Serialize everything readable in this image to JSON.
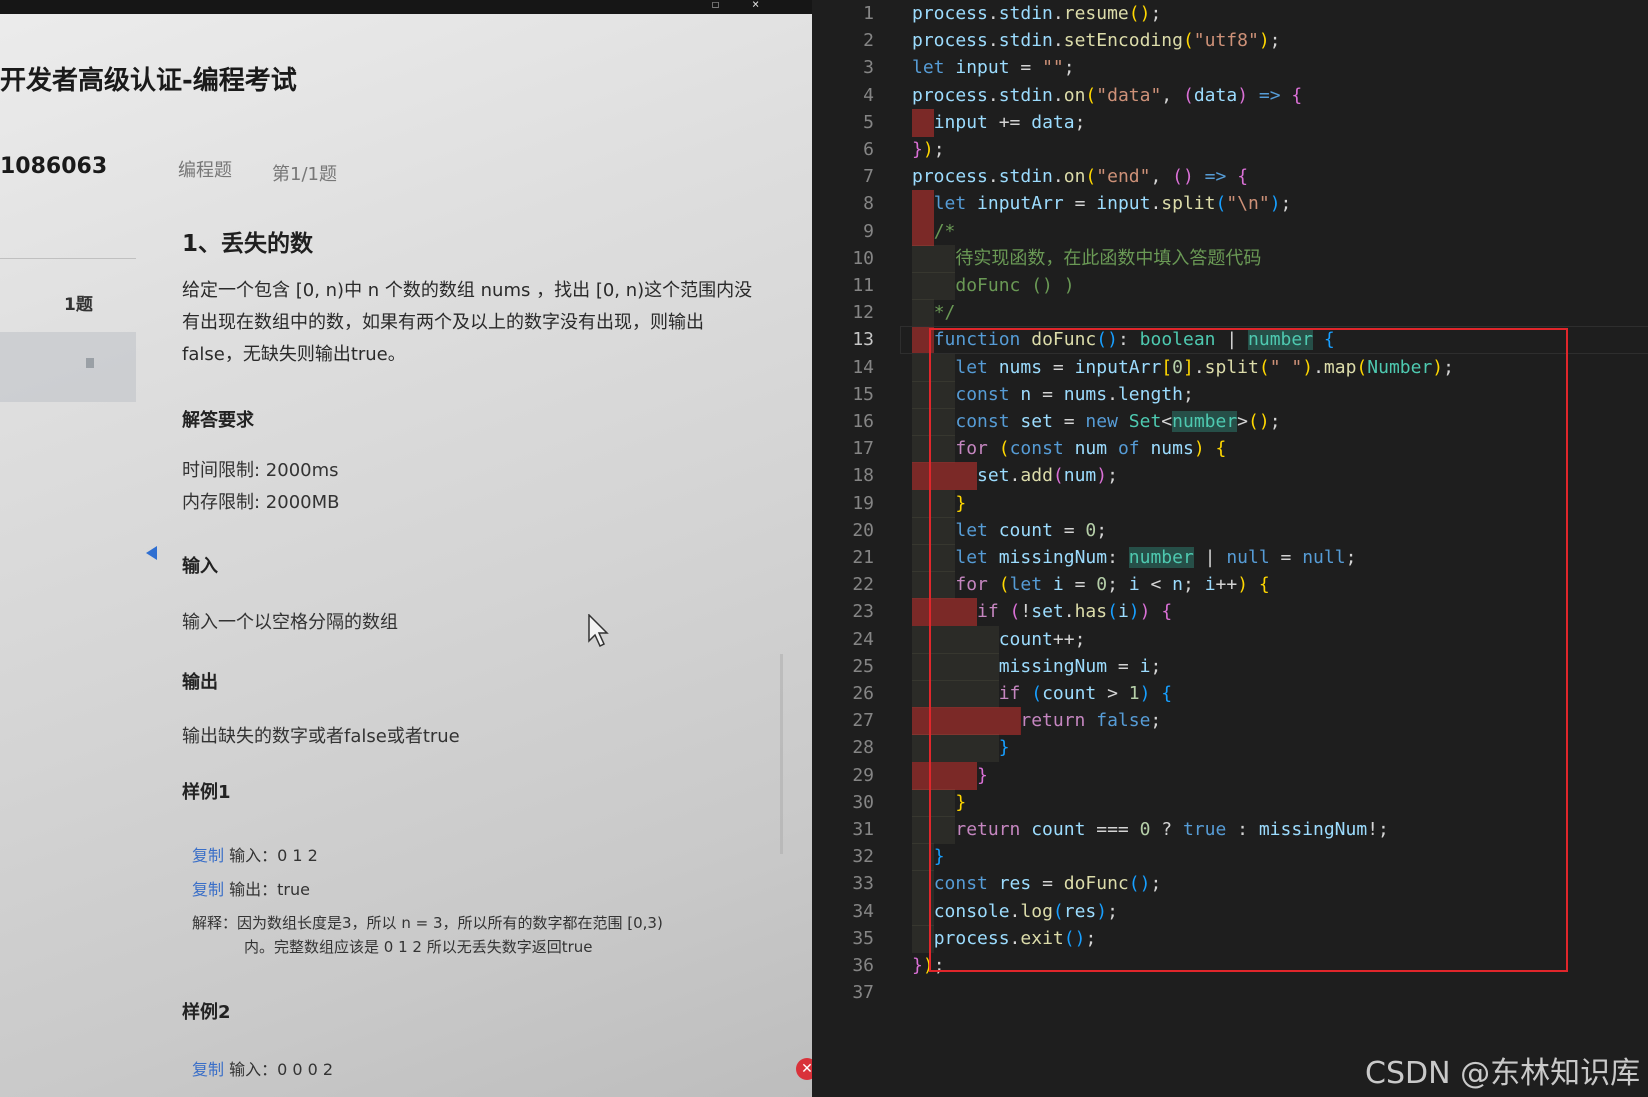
{
  "exam": {
    "title": "开发者高级认证-编程考试",
    "id": "1086063",
    "question_type": "编程题",
    "question_index": "第1/1题",
    "sidebar_question": "1题",
    "question_title": "1、丢失的数",
    "description": [
      "给定一个包含 [0, n)中 n 个数的数组 nums ，找出 [0, n)这个范围内没",
      "有出现在数组中的数，如果有两个及以上的数字没有出现，则输出",
      "false，无缺失则输出true。"
    ],
    "requirements_heading": "解答要求",
    "time_limit": "时间限制: 2000ms",
    "memory_limit": "内存限制: 2000MB",
    "input_heading": "输入",
    "input_text": "输入一个以空格分隔的数组",
    "output_heading": "输出",
    "output_text": "输出缺失的数字或者false或者true",
    "sample1_heading": "样例1",
    "sample1_input": "输入：0 1 2",
    "sample1_output": "输出：true",
    "sample1_explain_label": "解释：",
    "sample1_explain_1": "因为数组长度是3，所以 n = 3，所以所有的数字都在范围 [0,3)",
    "sample1_explain_2": "内。完整数组应该是 0 1 2 所以无丢失数字返回true",
    "sample2_heading": "样例2",
    "sample2_input": "输入：0 0 0 2",
    "copy_label": "复制"
  },
  "editor": {
    "active_line": 13,
    "lines": [
      {
        "n": "1",
        "tokens": [
          [
            "vr",
            "process"
          ],
          [
            "op",
            "."
          ],
          [
            "vr",
            "stdin"
          ],
          [
            "op",
            "."
          ],
          [
            "fn",
            "resume"
          ],
          [
            "b1",
            "()"
          ],
          [
            "op",
            ";"
          ]
        ]
      },
      {
        "n": "2",
        "tokens": [
          [
            "vr",
            "process"
          ],
          [
            "op",
            "."
          ],
          [
            "vr",
            "stdin"
          ],
          [
            "op",
            "."
          ],
          [
            "fn",
            "setEncoding"
          ],
          [
            "b1",
            "("
          ],
          [
            "st",
            "\"utf8\""
          ],
          [
            "b1",
            ")"
          ],
          [
            "op",
            ";"
          ]
        ]
      },
      {
        "n": "3",
        "tokens": [
          [
            "kw",
            "let "
          ],
          [
            "vr",
            "input"
          ],
          [
            "op",
            " = "
          ],
          [
            "st",
            "\"\""
          ],
          [
            "op",
            ";"
          ]
        ]
      },
      {
        "n": "4",
        "tokens": [
          [
            "vr",
            "process"
          ],
          [
            "op",
            "."
          ],
          [
            "vr",
            "stdin"
          ],
          [
            "op",
            "."
          ],
          [
            "fn",
            "on"
          ],
          [
            "b1",
            "("
          ],
          [
            "st",
            "\"data\""
          ],
          [
            "op",
            ", "
          ],
          [
            "b2",
            "("
          ],
          [
            "vr",
            "data"
          ],
          [
            "b2",
            ")"
          ],
          [
            "op",
            " "
          ],
          [
            "kw",
            "=>"
          ],
          [
            "op",
            " "
          ],
          [
            "b2",
            "{"
          ]
        ]
      },
      {
        "n": "5",
        "tokens": [
          [
            "op",
            "  "
          ],
          [
            "vr",
            "input"
          ],
          [
            "op",
            " += "
          ],
          [
            "vr",
            "data"
          ],
          [
            "op",
            ";"
          ]
        ]
      },
      {
        "n": "6",
        "tokens": [
          [
            "b2",
            "}"
          ],
          [
            "b1",
            ")"
          ],
          [
            "op",
            ";"
          ]
        ]
      },
      {
        "n": "7",
        "tokens": [
          [
            "vr",
            "process"
          ],
          [
            "op",
            "."
          ],
          [
            "vr",
            "stdin"
          ],
          [
            "op",
            "."
          ],
          [
            "fn",
            "on"
          ],
          [
            "b1",
            "("
          ],
          [
            "st",
            "\"end\""
          ],
          [
            "op",
            ", "
          ],
          [
            "b2",
            "()"
          ],
          [
            "op",
            " "
          ],
          [
            "kw",
            "=>"
          ],
          [
            "op",
            " "
          ],
          [
            "b2",
            "{"
          ]
        ]
      },
      {
        "n": "8",
        "tokens": [
          [
            "op",
            "  "
          ],
          [
            "kw",
            "let "
          ],
          [
            "vr",
            "inputArr"
          ],
          [
            "op",
            " = "
          ],
          [
            "vr",
            "input"
          ],
          [
            "op",
            "."
          ],
          [
            "fn",
            "split"
          ],
          [
            "b3",
            "("
          ],
          [
            "st",
            "\"\\n\""
          ],
          [
            "b3",
            ")"
          ],
          [
            "op",
            ";"
          ]
        ]
      },
      {
        "n": "9",
        "tokens": [
          [
            "op",
            "  "
          ],
          [
            "cm",
            "/*"
          ]
        ]
      },
      {
        "n": "10",
        "tokens": [
          [
            "op",
            "    "
          ],
          [
            "cm",
            "待实现函数，在此函数中填入答题代码"
          ]
        ]
      },
      {
        "n": "11",
        "tokens": [
          [
            "op",
            "    "
          ],
          [
            "cm",
            "doFunc () )"
          ]
        ]
      },
      {
        "n": "12",
        "tokens": [
          [
            "op",
            "  "
          ],
          [
            "cm",
            "*/"
          ]
        ]
      },
      {
        "n": "13",
        "tokens": [
          [
            "op",
            "  "
          ],
          [
            "kw",
            "function "
          ],
          [
            "fn",
            "doFunc"
          ],
          [
            "b3",
            "()"
          ],
          [
            "op",
            ": "
          ],
          [
            "ty",
            "boolean"
          ],
          [
            "op",
            " | "
          ],
          [
            "tyh",
            "number"
          ],
          [
            "op",
            " "
          ],
          [
            "b3",
            "{"
          ]
        ]
      },
      {
        "n": "14",
        "tokens": [
          [
            "op",
            "    "
          ],
          [
            "kw",
            "let "
          ],
          [
            "vr",
            "nums"
          ],
          [
            "op",
            " = "
          ],
          [
            "vr",
            "inputArr"
          ],
          [
            "b1",
            "["
          ],
          [
            "nm",
            "0"
          ],
          [
            "b1",
            "]"
          ],
          [
            "op",
            "."
          ],
          [
            "fn",
            "split"
          ],
          [
            "b1",
            "("
          ],
          [
            "st",
            "\" \""
          ],
          [
            "b1",
            ")"
          ],
          [
            "op",
            "."
          ],
          [
            "fn",
            "map"
          ],
          [
            "b1",
            "("
          ],
          [
            "ty",
            "Number"
          ],
          [
            "b1",
            ")"
          ],
          [
            "op",
            ";"
          ]
        ]
      },
      {
        "n": "15",
        "tokens": [
          [
            "op",
            "    "
          ],
          [
            "kw",
            "const "
          ],
          [
            "vr",
            "n"
          ],
          [
            "op",
            " = "
          ],
          [
            "vr",
            "nums"
          ],
          [
            "op",
            "."
          ],
          [
            "vr",
            "length"
          ],
          [
            "op",
            ";"
          ]
        ]
      },
      {
        "n": "16",
        "tokens": [
          [
            "op",
            "    "
          ],
          [
            "kw",
            "const "
          ],
          [
            "vr",
            "set"
          ],
          [
            "op",
            " = "
          ],
          [
            "kw",
            "new "
          ],
          [
            "ty",
            "Set"
          ],
          [
            "op",
            "<"
          ],
          [
            "tyh",
            "number"
          ],
          [
            "op",
            ">"
          ],
          [
            "b1",
            "()"
          ],
          [
            "op",
            ";"
          ]
        ]
      },
      {
        "n": "17",
        "tokens": [
          [
            "op",
            "    "
          ],
          [
            "ctl",
            "for "
          ],
          [
            "b1",
            "("
          ],
          [
            "kw",
            "const "
          ],
          [
            "vr",
            "num"
          ],
          [
            "kw",
            " of "
          ],
          [
            "vr",
            "nums"
          ],
          [
            "b1",
            ")"
          ],
          [
            "op",
            " "
          ],
          [
            "b1",
            "{"
          ]
        ]
      },
      {
        "n": "18",
        "tokens": [
          [
            "op",
            "      "
          ],
          [
            "vr",
            "set"
          ],
          [
            "op",
            "."
          ],
          [
            "fn",
            "add"
          ],
          [
            "b2",
            "("
          ],
          [
            "vr",
            "num"
          ],
          [
            "b2",
            ")"
          ],
          [
            "op",
            ";"
          ]
        ]
      },
      {
        "n": "19",
        "tokens": [
          [
            "op",
            "    "
          ],
          [
            "b1",
            "}"
          ]
        ]
      },
      {
        "n": "20",
        "tokens": [
          [
            "op",
            "    "
          ],
          [
            "kw",
            "let "
          ],
          [
            "vr",
            "count"
          ],
          [
            "op",
            " = "
          ],
          [
            "nm",
            "0"
          ],
          [
            "op",
            ";"
          ]
        ]
      },
      {
        "n": "21",
        "tokens": [
          [
            "op",
            "    "
          ],
          [
            "kw",
            "let "
          ],
          [
            "vr",
            "missingNum"
          ],
          [
            "op",
            ": "
          ],
          [
            "tyh",
            "number"
          ],
          [
            "op",
            " | "
          ],
          [
            "kw",
            "null"
          ],
          [
            "op",
            " = "
          ],
          [
            "kw",
            "null"
          ],
          [
            "op",
            ";"
          ]
        ]
      },
      {
        "n": "22",
        "tokens": [
          [
            "op",
            "    "
          ],
          [
            "ctl",
            "for "
          ],
          [
            "b1",
            "("
          ],
          [
            "kw",
            "let "
          ],
          [
            "vr",
            "i"
          ],
          [
            "op",
            " = "
          ],
          [
            "nm",
            "0"
          ],
          [
            "op",
            "; "
          ],
          [
            "vr",
            "i"
          ],
          [
            "op",
            " < "
          ],
          [
            "vr",
            "n"
          ],
          [
            "op",
            "; "
          ],
          [
            "vr",
            "i"
          ],
          [
            "op",
            "++"
          ],
          [
            "b1",
            ")"
          ],
          [
            "op",
            " "
          ],
          [
            "b1",
            "{"
          ]
        ]
      },
      {
        "n": "23",
        "tokens": [
          [
            "op",
            "      "
          ],
          [
            "ctl",
            "if "
          ],
          [
            "b2",
            "("
          ],
          [
            "op",
            "!"
          ],
          [
            "vr",
            "set"
          ],
          [
            "op",
            "."
          ],
          [
            "fn",
            "has"
          ],
          [
            "b3",
            "("
          ],
          [
            "vr",
            "i"
          ],
          [
            "b3",
            ")"
          ],
          [
            "b2",
            ")"
          ],
          [
            "op",
            " "
          ],
          [
            "b2",
            "{"
          ]
        ]
      },
      {
        "n": "24",
        "tokens": [
          [
            "op",
            "        "
          ],
          [
            "vr",
            "count"
          ],
          [
            "op",
            "++;"
          ]
        ]
      },
      {
        "n": "25",
        "tokens": [
          [
            "op",
            "        "
          ],
          [
            "vr",
            "missingNum"
          ],
          [
            "op",
            " = "
          ],
          [
            "vr",
            "i"
          ],
          [
            "op",
            ";"
          ]
        ]
      },
      {
        "n": "26",
        "tokens": [
          [
            "op",
            "        "
          ],
          [
            "ctl",
            "if "
          ],
          [
            "b3",
            "("
          ],
          [
            "vr",
            "count"
          ],
          [
            "op",
            " > "
          ],
          [
            "nm",
            "1"
          ],
          [
            "b3",
            ")"
          ],
          [
            "op",
            " "
          ],
          [
            "b3",
            "{"
          ]
        ]
      },
      {
        "n": "27",
        "tokens": [
          [
            "op",
            "          "
          ],
          [
            "ctl",
            "return "
          ],
          [
            "kw",
            "false"
          ],
          [
            "op",
            ";"
          ]
        ]
      },
      {
        "n": "28",
        "tokens": [
          [
            "op",
            "        "
          ],
          [
            "b3",
            "}"
          ]
        ]
      },
      {
        "n": "29",
        "tokens": [
          [
            "op",
            "      "
          ],
          [
            "b2",
            "}"
          ]
        ]
      },
      {
        "n": "30",
        "tokens": [
          [
            "op",
            "    "
          ],
          [
            "b1",
            "}"
          ]
        ]
      },
      {
        "n": "31",
        "tokens": [
          [
            "op",
            "    "
          ],
          [
            "ctl",
            "return "
          ],
          [
            "vr",
            "count"
          ],
          [
            "op",
            " === "
          ],
          [
            "nm",
            "0"
          ],
          [
            "op",
            " ? "
          ],
          [
            "kw",
            "true"
          ],
          [
            "op",
            " : "
          ],
          [
            "vr",
            "missingNum"
          ],
          [
            "op",
            "!;"
          ]
        ]
      },
      {
        "n": "32",
        "tokens": [
          [
            "op",
            "  "
          ],
          [
            "b3",
            "}"
          ]
        ]
      },
      {
        "n": "33",
        "tokens": [
          [
            "op",
            "  "
          ],
          [
            "kw",
            "const "
          ],
          [
            "vr",
            "res"
          ],
          [
            "op",
            " = "
          ],
          [
            "fn",
            "doFunc"
          ],
          [
            "b3",
            "()"
          ],
          [
            "op",
            ";"
          ]
        ]
      },
      {
        "n": "34",
        "tokens": [
          [
            "op",
            "  "
          ],
          [
            "vr",
            "console"
          ],
          [
            "op",
            "."
          ],
          [
            "fn",
            "log"
          ],
          [
            "b3",
            "("
          ],
          [
            "vr",
            "res"
          ],
          [
            "b3",
            ")"
          ],
          [
            "op",
            ";"
          ]
        ]
      },
      {
        "n": "35",
        "tokens": [
          [
            "op",
            "  "
          ],
          [
            "vr",
            "process"
          ],
          [
            "op",
            "."
          ],
          [
            "fn",
            "exit"
          ],
          [
            "b3",
            "()"
          ],
          [
            "op",
            ";"
          ]
        ]
      },
      {
        "n": "36",
        "tokens": [
          [
            "b2",
            "}"
          ],
          [
            "b1",
            ")"
          ],
          [
            "op",
            ";"
          ]
        ]
      },
      {
        "n": "37",
        "tokens": []
      }
    ],
    "error_lines": [
      "5",
      "8",
      "9",
      "13",
      "18",
      "23",
      "27",
      "29"
    ]
  },
  "watermark": "CSDN @东林知识库",
  "colors": {
    "editor_bg": "#1e1e1e",
    "highlight_box": "#e0262b",
    "keyword": "#569cd6",
    "control": "#c586c0",
    "function": "#dcdcaa",
    "variable": "#9cdcfe",
    "string": "#ce9178",
    "number": "#b5cea8",
    "type": "#4ec9b0",
    "comment": "#6a9955",
    "copy_link": "#3a6fc8"
  }
}
